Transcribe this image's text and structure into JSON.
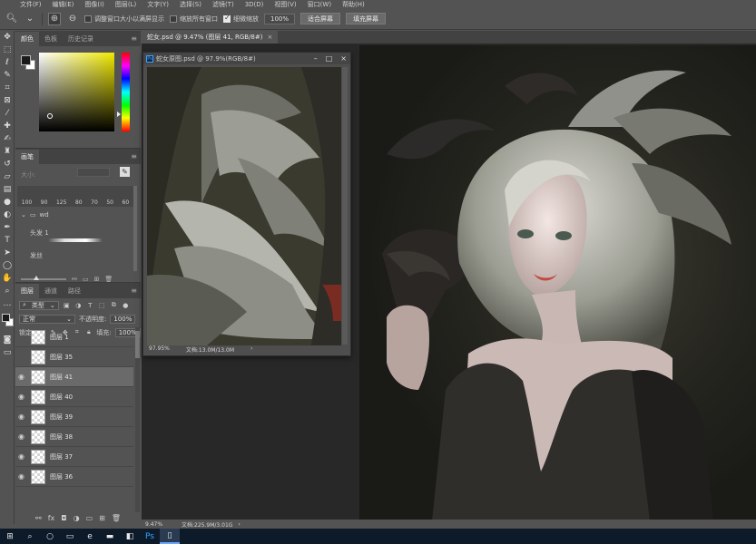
{
  "menu": [
    "文件(F)",
    "编辑(E)",
    "图像(I)",
    "图层(L)",
    "文字(Y)",
    "选择(S)",
    "滤镜(T)",
    "3D(D)",
    "视图(V)",
    "窗口(W)",
    "帮助(H)"
  ],
  "options": {
    "resize_windows": "调整窗口大小以满屏显示",
    "zoom_all": "缩放所有窗口",
    "scrubby_zoom": "细微缩放",
    "zoom_value": "100%",
    "fit_screen": "适合屏幕",
    "fill_screen": "填充屏幕"
  },
  "color_panel": {
    "tabs": [
      "颜色",
      "色板",
      "历史记录"
    ]
  },
  "brush_panel": {
    "tab": "画笔",
    "size_label": "大小:",
    "presets": [
      "100",
      "90",
      "125",
      "80",
      "70",
      "50",
      "60"
    ],
    "folder": "wd",
    "items": [
      "头发 1",
      "发丝"
    ]
  },
  "layers_panel": {
    "tabs": [
      "图层",
      "通道",
      "路径"
    ],
    "filter": "类型",
    "blend_mode": "正常",
    "opacity_label": "不透明度:",
    "opacity_value": "100%",
    "lock_label": "锁定:",
    "fill_label": "填充:",
    "fill_value": "100%",
    "layers": [
      {
        "name": "图层 1",
        "visible": false,
        "selected": false
      },
      {
        "name": "图层 35",
        "visible": false,
        "selected": false
      },
      {
        "name": "图层 41",
        "visible": true,
        "selected": true
      },
      {
        "name": "图层 40",
        "visible": true,
        "selected": false
      },
      {
        "name": "图层 39",
        "visible": true,
        "selected": false
      },
      {
        "name": "图层 38",
        "visible": true,
        "selected": false
      },
      {
        "name": "图层 37",
        "visible": true,
        "selected": false
      },
      {
        "name": "图层 36",
        "visible": true,
        "selected": false
      }
    ]
  },
  "document": {
    "tab_title": "蛇女.psd @ 9.47% (图层 41, RGB/8#)",
    "zoom": "9.47%",
    "doc_size": "文档:225.9M/3.01G"
  },
  "floating_window": {
    "title": "蛇女原图.psd @ 97.9%(RGB/8#)",
    "zoom": "97.95%",
    "doc_size": "文档:13.0M/13.0M"
  },
  "colors": {
    "ui_bg": "#535353",
    "panel_dark": "#424242",
    "selected_layer": "#6a6a6a",
    "canvas_bg": "#282828",
    "taskbar": "#0d1a2a"
  }
}
